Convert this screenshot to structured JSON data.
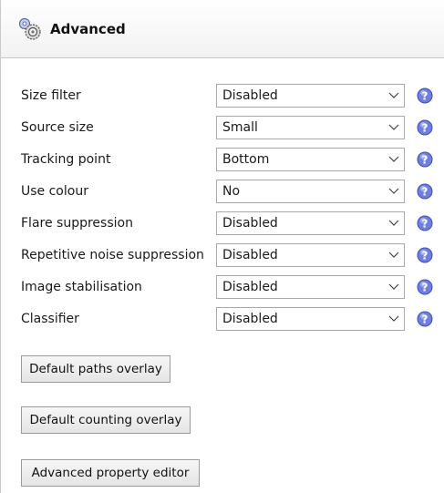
{
  "header": {
    "title": "Advanced",
    "icon": "gears-icon"
  },
  "rows": [
    {
      "label": "Size filter",
      "value": "Disabled"
    },
    {
      "label": "Source size",
      "value": "Small"
    },
    {
      "label": "Tracking point",
      "value": "Bottom"
    },
    {
      "label": "Use colour",
      "value": "No"
    },
    {
      "label": "Flare suppression",
      "value": "Disabled"
    },
    {
      "label": "Repetitive noise suppression",
      "value": "Disabled"
    },
    {
      "label": "Image stabilisation",
      "value": "Disabled"
    },
    {
      "label": "Classifier",
      "value": "Disabled"
    }
  ],
  "buttons": {
    "default_paths": "Default paths overlay",
    "default_counting": "Default counting overlay",
    "advanced_editor": "Advanced property editor"
  },
  "colors": {
    "help_icon": "#6f7fe0",
    "border": "#a9a9a9"
  }
}
